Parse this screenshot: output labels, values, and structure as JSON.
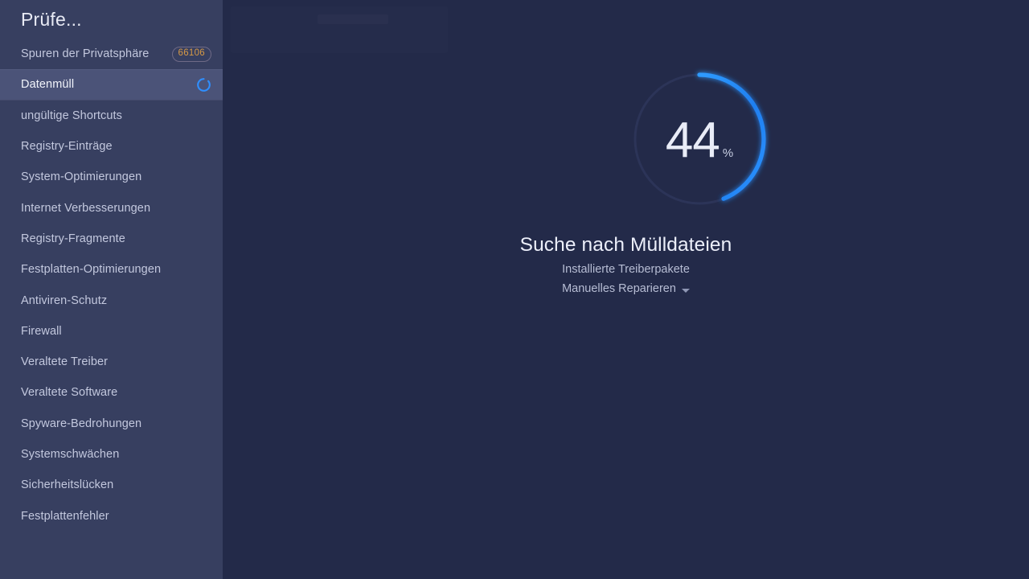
{
  "sidebar": {
    "title": "Prüfe...",
    "items": [
      {
        "label": "Spuren der Privatsphäre",
        "badge": "66106",
        "selected": false,
        "spinner": false
      },
      {
        "label": "Datenmüll",
        "badge": null,
        "selected": true,
        "spinner": true
      },
      {
        "label": "ungültige Shortcuts",
        "badge": null,
        "selected": false,
        "spinner": false
      },
      {
        "label": "Registry-Einträge",
        "badge": null,
        "selected": false,
        "spinner": false
      },
      {
        "label": "System-Optimierungen",
        "badge": null,
        "selected": false,
        "spinner": false
      },
      {
        "label": "Internet Verbesserungen",
        "badge": null,
        "selected": false,
        "spinner": false
      },
      {
        "label": "Registry-Fragmente",
        "badge": null,
        "selected": false,
        "spinner": false
      },
      {
        "label": "Festplatten-Optimierungen",
        "badge": null,
        "selected": false,
        "spinner": false
      },
      {
        "label": "Antiviren-Schutz",
        "badge": null,
        "selected": false,
        "spinner": false
      },
      {
        "label": "Firewall",
        "badge": null,
        "selected": false,
        "spinner": false
      },
      {
        "label": "Veraltete Treiber",
        "badge": null,
        "selected": false,
        "spinner": false
      },
      {
        "label": "Veraltete Software",
        "badge": null,
        "selected": false,
        "spinner": false
      },
      {
        "label": "Spyware-Bedrohungen",
        "badge": null,
        "selected": false,
        "spinner": false
      },
      {
        "label": "Systemschwächen",
        "badge": null,
        "selected": false,
        "spinner": false
      },
      {
        "label": "Sicherheitslücken",
        "badge": null,
        "selected": false,
        "spinner": false
      },
      {
        "label": "Festplattenfehler",
        "badge": null,
        "selected": false,
        "spinner": false
      }
    ]
  },
  "main": {
    "progress": {
      "value": 44,
      "unit": "%",
      "sweep_degrees": 158,
      "arc_color": "#1f7ff0",
      "arc_color_end": "#2f9bff",
      "track_color": "#2c3458"
    },
    "heading": "Suche nach Mülldateien",
    "subtitle": "Installierte Treiberpakete",
    "action_label": "Manuelles Reparieren",
    "action_icon": "chevron-down-icon"
  },
  "colors": {
    "sidebar_bg": "#373f60",
    "sidebar_selected_bg": "#4b5378",
    "main_bg": "#232a49",
    "accent_blue": "#2f9bff",
    "badge_text": "#d79a46",
    "badge_border": "#6f6a86",
    "text_primary": "#eceffa",
    "text_secondary": "#b7bdd4"
  }
}
